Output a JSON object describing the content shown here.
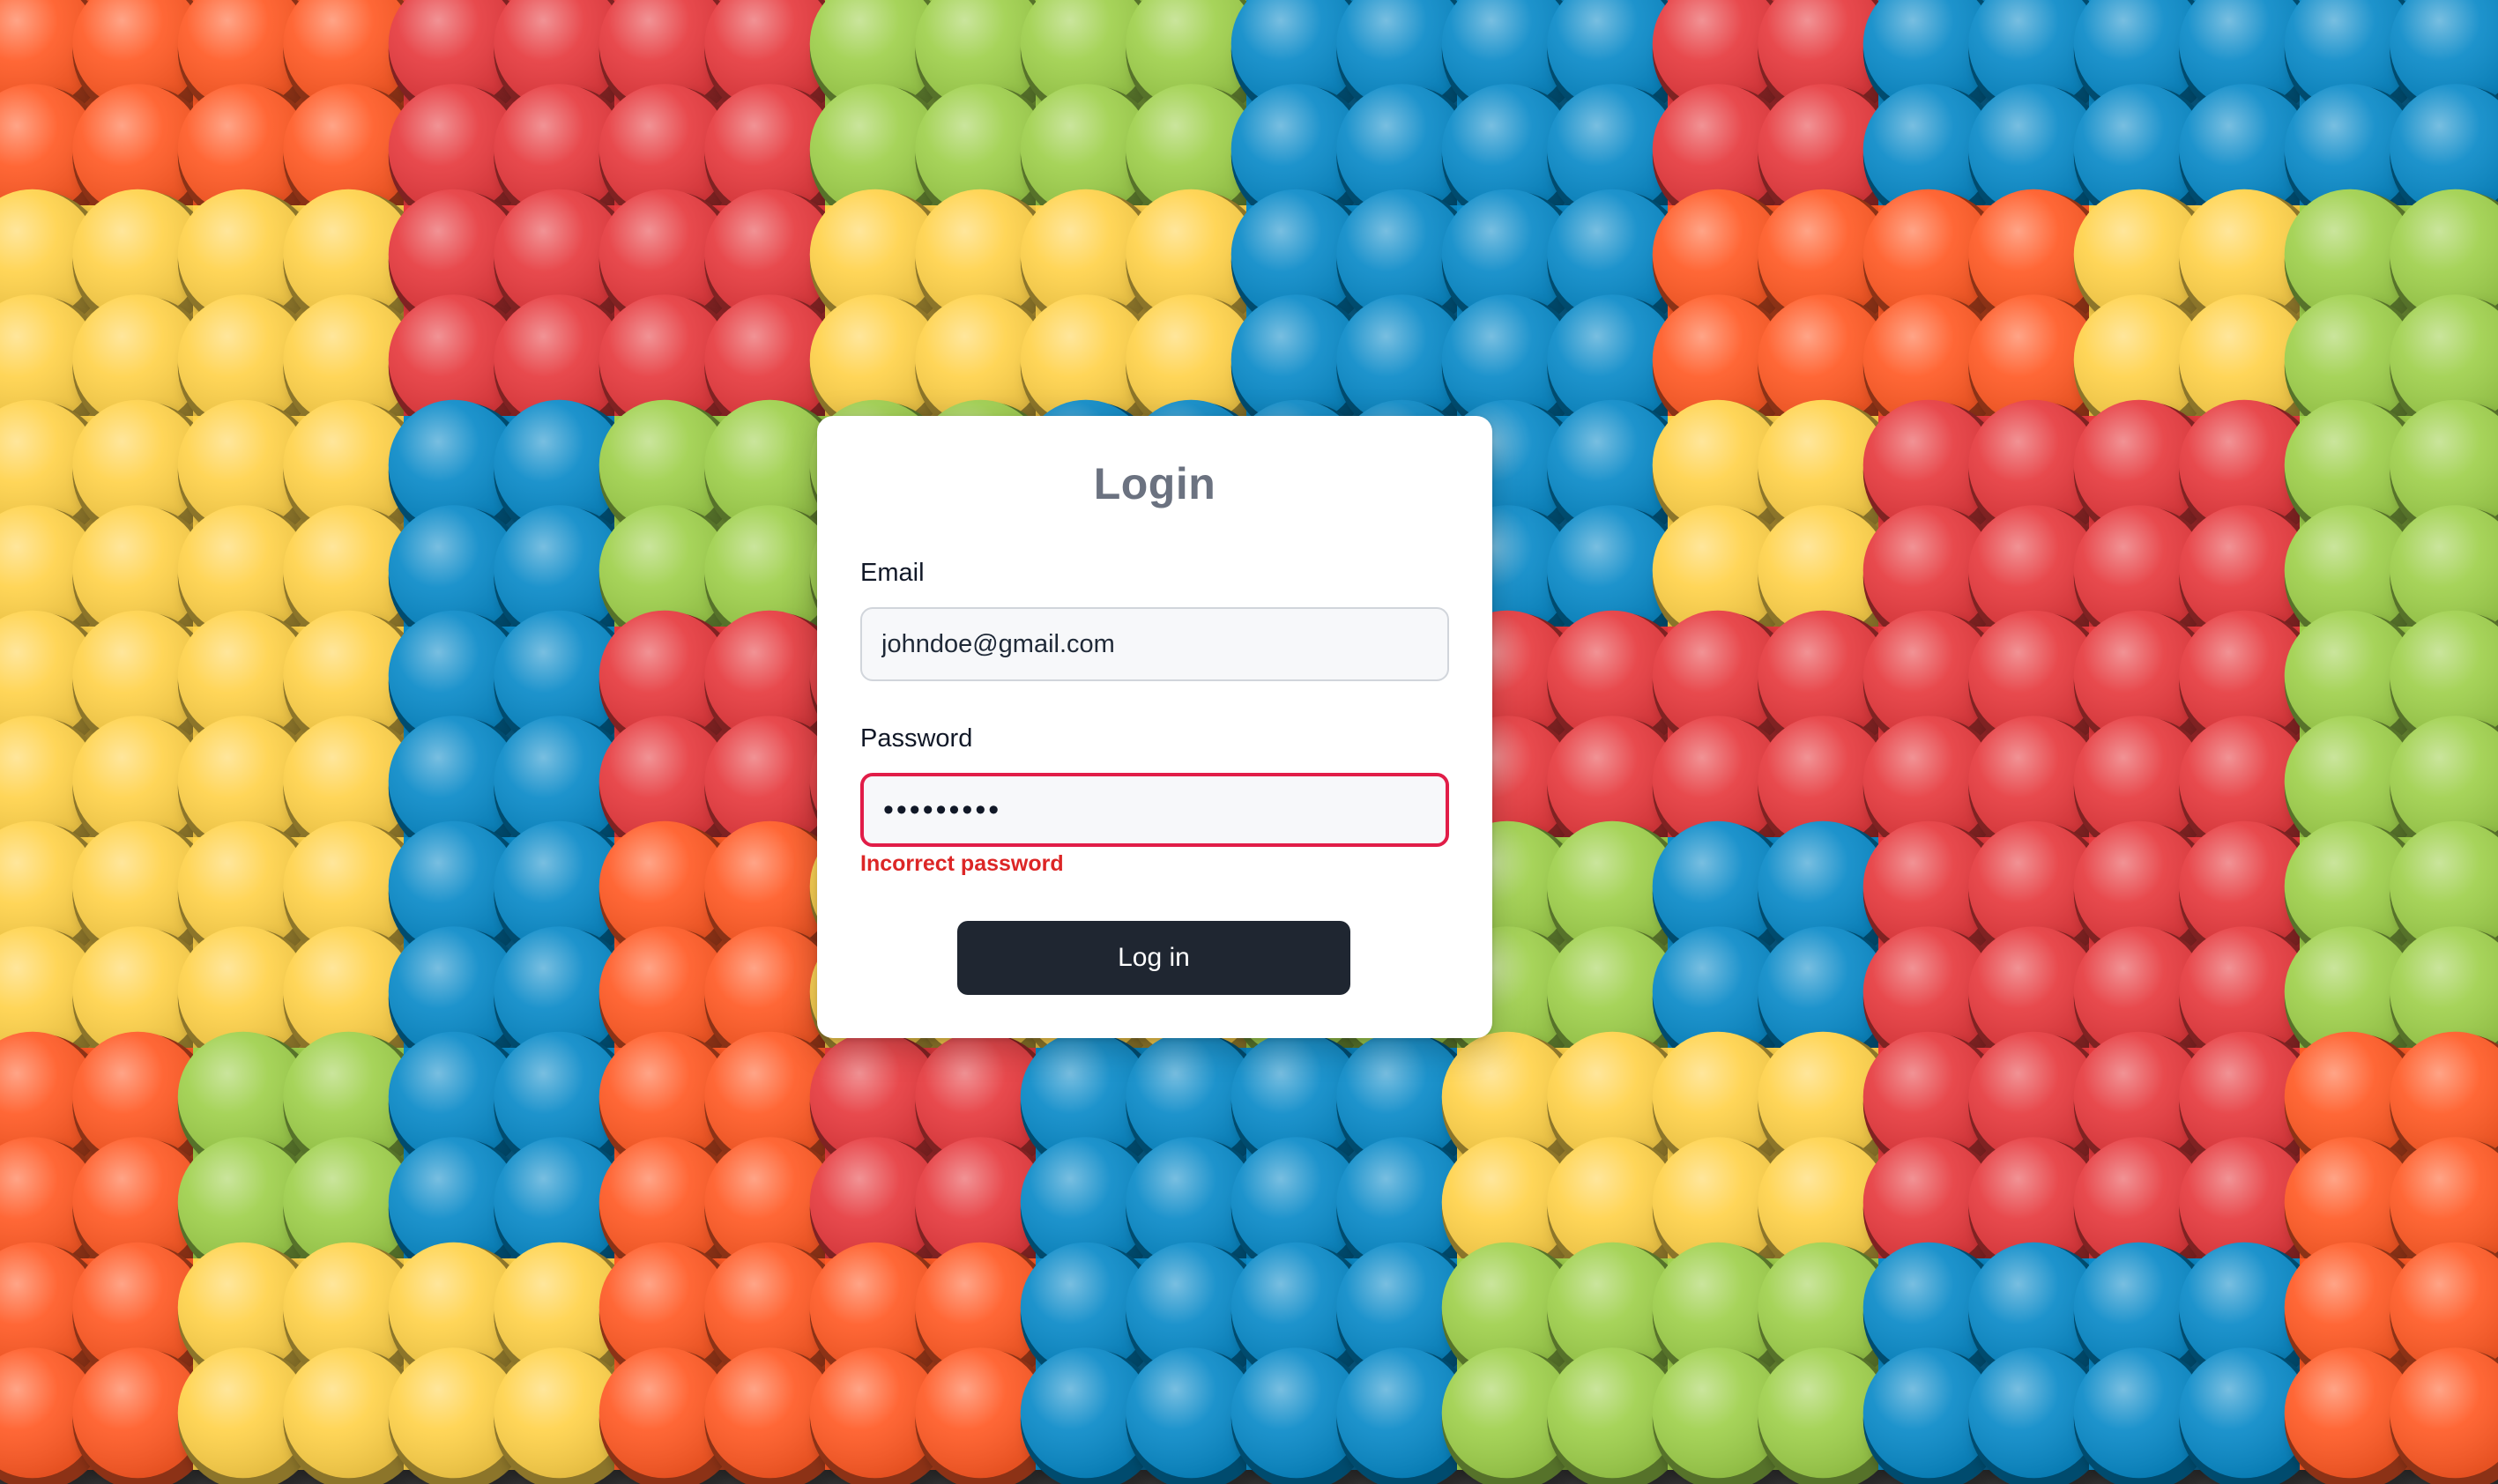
{
  "background": {
    "description_icon": "lego-brick-pattern",
    "colors": {
      "red": "#e63a3e",
      "orange": "#ff5a25",
      "yellow": "#ffd24a",
      "green": "#9fd04c",
      "blue": "#0a8ac8"
    }
  },
  "login": {
    "title": "Login",
    "email_label": "Email",
    "email_value": "johndoe@gmail.com",
    "password_label": "Password",
    "password_value": "•••••••••",
    "error_message": "Incorrect password",
    "submit_label": "Log in"
  },
  "colors": {
    "error": "#dc2626",
    "error_border": "#e11d48",
    "button_bg": "#1f2631",
    "title": "#6b7280"
  }
}
